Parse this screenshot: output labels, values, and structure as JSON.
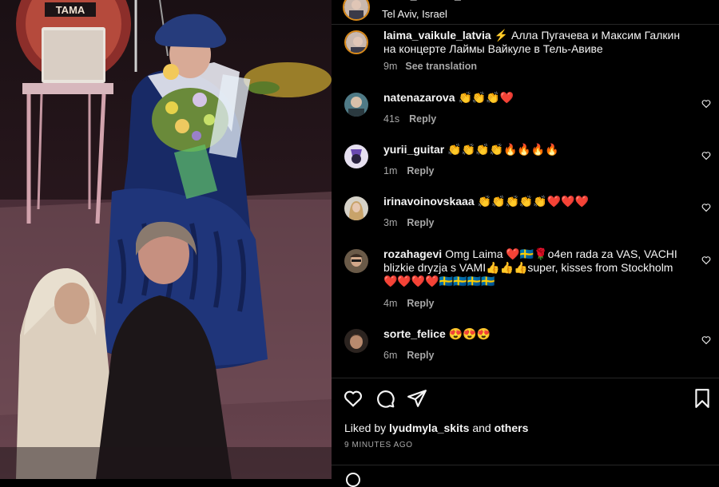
{
  "post": {
    "username": "laima_vaikule_latvia",
    "location": "Tel Aviv, Israel",
    "drum_brand": "TAMA"
  },
  "caption": {
    "username": "laima_vaikule_latvia",
    "text": "⚡ Алла Пугачева и Максим Галкин на концерте Лаймы Вайкуле в Тель-Авиве",
    "time": "9m",
    "translation_label": "See translation"
  },
  "comments": [
    {
      "username": "natenazarova",
      "text": "👏👏👏❤️",
      "time": "41s",
      "reply": "Reply"
    },
    {
      "username": "yurii_guitar",
      "text": "👏👏👏👏🔥🔥🔥🔥",
      "time": "1m",
      "reply": "Reply"
    },
    {
      "username": "irinavoinovskaaa",
      "text": "👏👏👏👏👏❤️❤️❤️",
      "time": "3m",
      "reply": "Reply"
    },
    {
      "username": "rozahagevi",
      "text": "Omg Laima ❤️🇸🇪🌹o4en rada za VAS, VACHI blizkie dryzja s VAMI👍👍👍super, kisses from Stockholm ❤️❤️❤️❤️🇸🇪🇸🇪🇸🇪🇸🇪",
      "time": "4m",
      "reply": "Reply"
    },
    {
      "username": "sorte_felice",
      "text": "😍😍😍",
      "time": "6m",
      "reply": "Reply"
    }
  ],
  "likes": {
    "prefix": "Liked by",
    "user": "lyudmyla_skits",
    "and": "and",
    "others": "others"
  },
  "timestamp": "9 MINUTES AGO",
  "colors": {
    "background": "#000000",
    "text": "#f5f5f5",
    "muted": "#a8a8a8",
    "story_ring": "#d98a1a"
  }
}
